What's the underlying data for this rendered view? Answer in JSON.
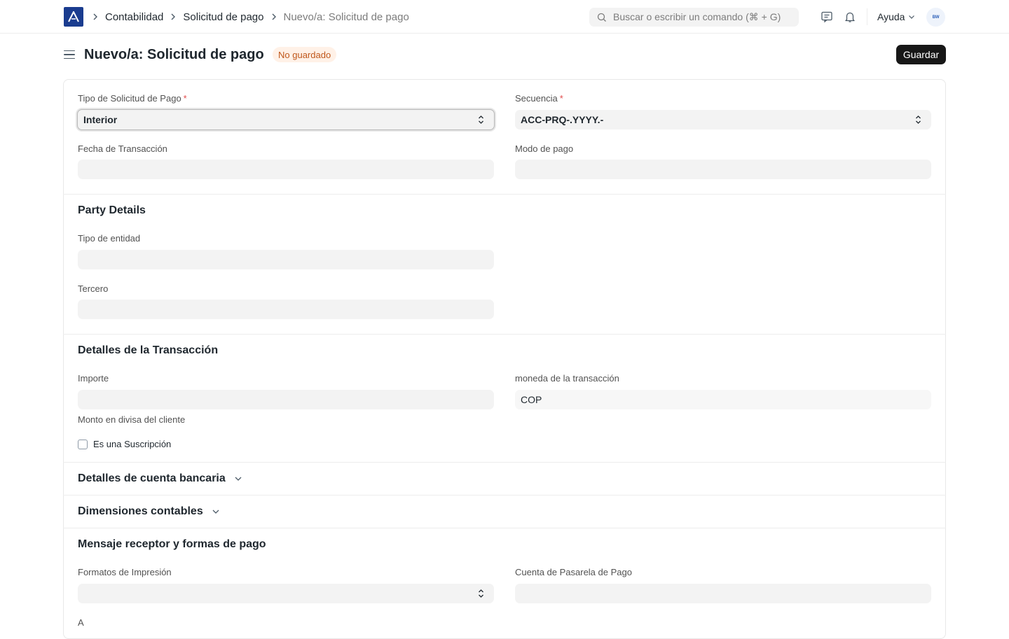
{
  "navbar": {
    "logo_icon": "app-logo-icon",
    "breadcrumbs": [
      "Contabilidad",
      "Solicitud de pago",
      "Nuevo/a: Solicitud de pago"
    ],
    "search_placeholder": "Buscar o escribir un comando (⌘ + G)",
    "help_label": "Ayuda",
    "avatar_initials": "BW"
  },
  "page": {
    "title": "Nuevo/a: Solicitud de pago",
    "status": "No guardado",
    "save_label": "Guardar"
  },
  "form": {
    "payment_request_type": {
      "label": "Tipo de Solicitud de Pago",
      "value": "Interior"
    },
    "series": {
      "label": "Secuencia",
      "value": "ACC-PRQ-.YYYY.-"
    },
    "transaction_date": {
      "label": "Fecha de Transacción",
      "value": ""
    },
    "mode_of_payment": {
      "label": "Modo de pago",
      "value": ""
    },
    "party_section": {
      "title": "Party Details",
      "party_type": {
        "label": "Tipo de entidad",
        "value": ""
      },
      "party": {
        "label": "Tercero",
        "value": ""
      }
    },
    "transaction_section": {
      "title": "Detalles de la Transacción",
      "amount": {
        "label": "Importe",
        "value": ""
      },
      "currency": {
        "label": "moneda de la transacción",
        "value": "COP"
      },
      "grand_total_label": "Monto en divisa del cliente",
      "subscription_label": "Es una Suscripción",
      "subscription_checked": false
    },
    "bank_section_title": "Detalles de cuenta bancaria",
    "accounting_section_title": "Dimensiones contables",
    "message_section": {
      "title": "Mensaje receptor y formas de pago",
      "print_format": {
        "label": "Formatos de Impresión",
        "value": ""
      },
      "gateway_account": {
        "label": "Cuenta de Pasarela de Pago",
        "value": ""
      },
      "to_label": "A"
    }
  },
  "colors": {
    "accent": "#171717",
    "logo": "#1a3c8f",
    "status_text": "#c0571b",
    "status_bg": "#fff1e7",
    "required": "#e24c4c"
  }
}
